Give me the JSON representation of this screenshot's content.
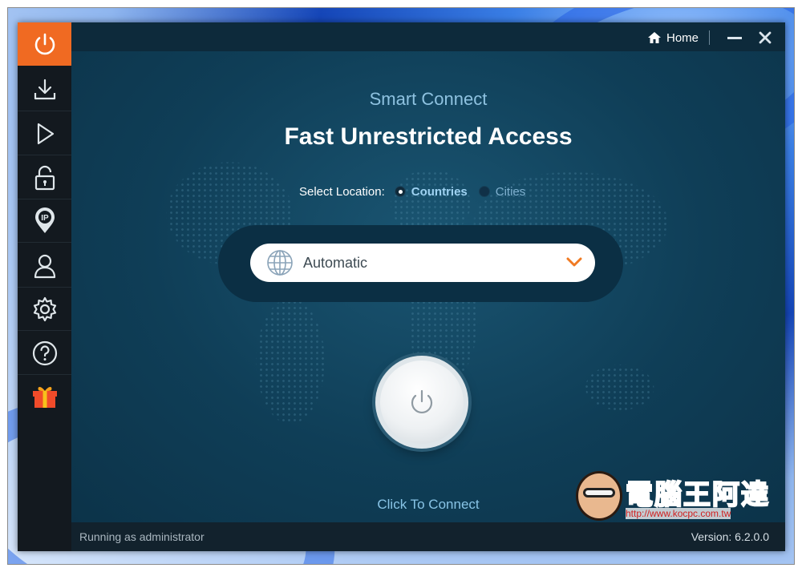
{
  "titlebar": {
    "home_label": "Home"
  },
  "sidebar": {
    "items": [
      {
        "icon": "power-icon",
        "active": true
      },
      {
        "icon": "download-icon"
      },
      {
        "icon": "play-icon"
      },
      {
        "icon": "lock-icon"
      },
      {
        "icon": "ip-location-icon"
      },
      {
        "icon": "user-icon"
      },
      {
        "icon": "gear-icon"
      },
      {
        "icon": "help-icon"
      },
      {
        "icon": "gift-icon"
      }
    ]
  },
  "main": {
    "subtitle": "Smart Connect",
    "title": "Fast Unrestricted Access",
    "location": {
      "label": "Select Location:",
      "options": [
        "Countries",
        "Cities"
      ],
      "selected": "Countries"
    },
    "dropdown": {
      "value": "Automatic",
      "icon": "globe-icon"
    },
    "connect_label": "Click To Connect"
  },
  "status": {
    "left": "Running as administrator",
    "version": "Version:  6.2.0.0"
  },
  "watermark": {
    "text": "電腦王阿達",
    "url": "http://www.kocpc.com.tw"
  },
  "colors": {
    "accent": "#f06a22",
    "sidebar": "#13191f",
    "main_bg": "#0f3e57",
    "link": "#88c4e6"
  }
}
